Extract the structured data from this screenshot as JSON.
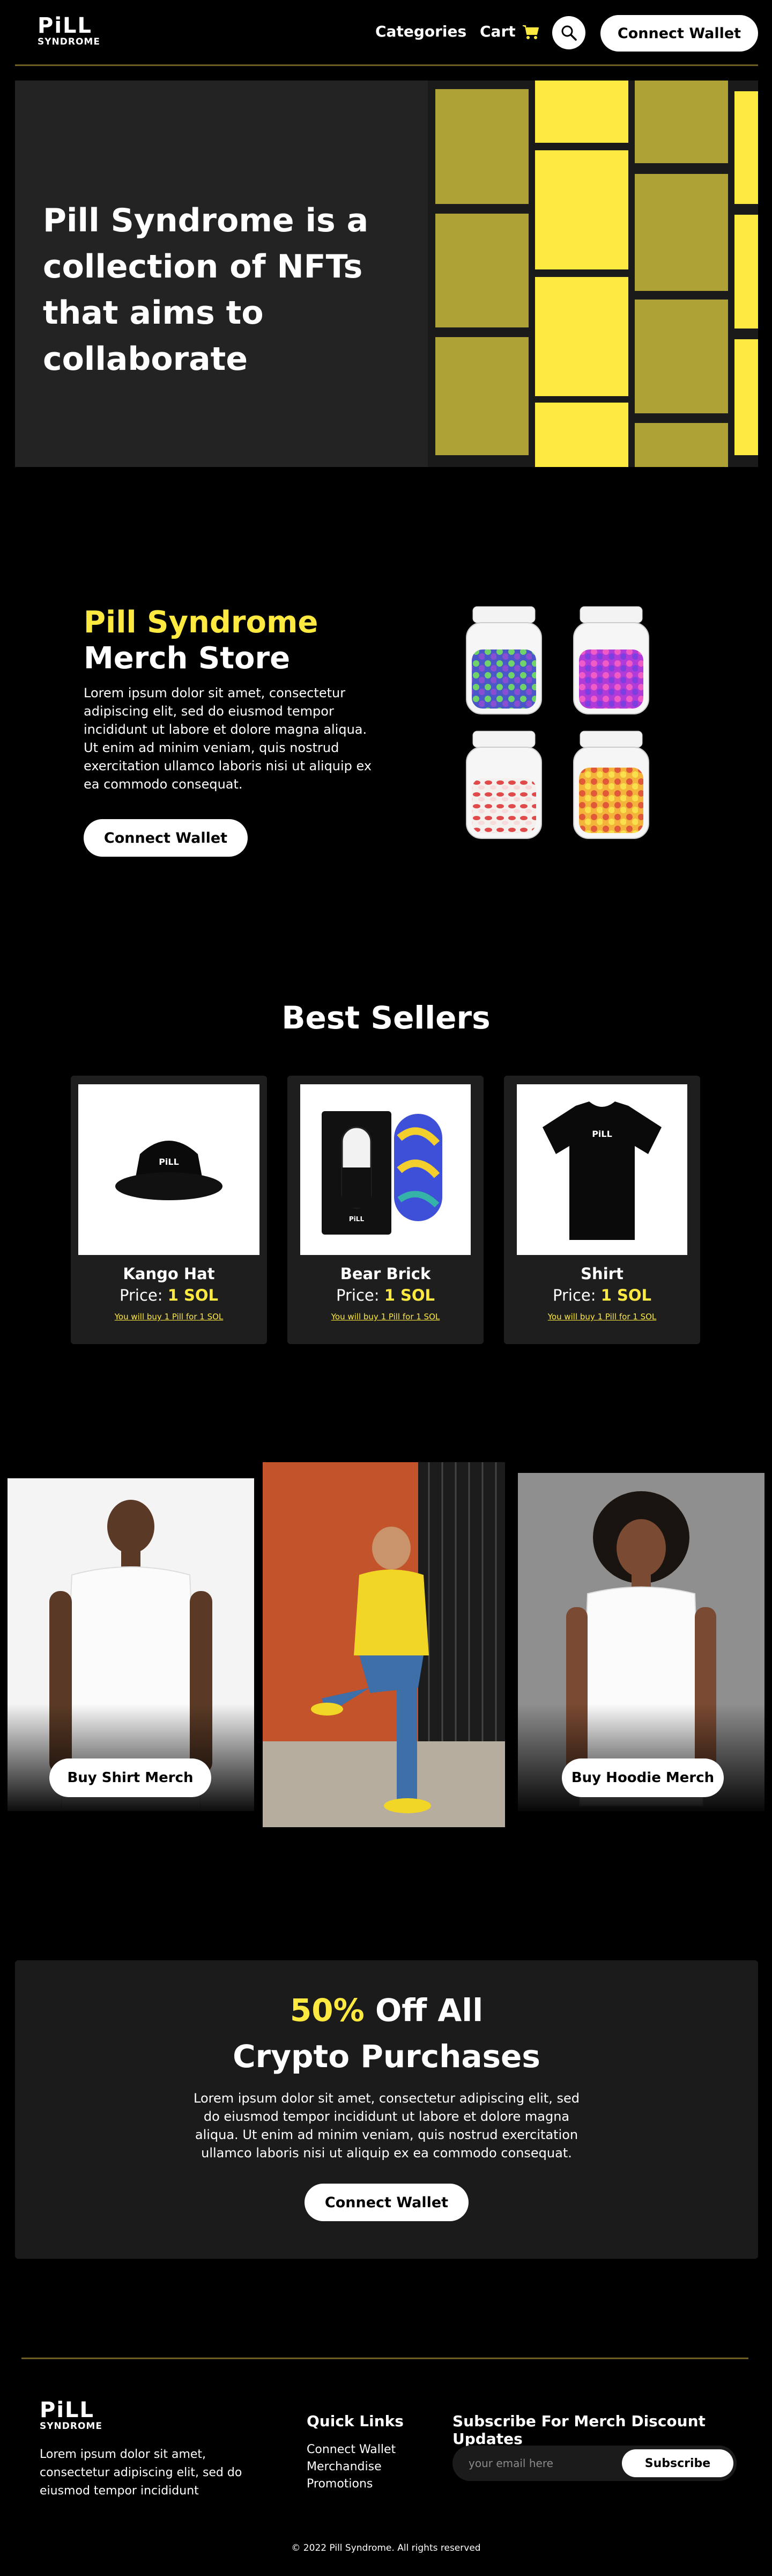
{
  "colors": {
    "accent": "#fee940",
    "background": "#000000",
    "panel": "#232323"
  },
  "header": {
    "logo_line1": "PiLL",
    "logo_line2": "SYNDROME",
    "nav_categories": "Categories",
    "nav_cart": "Cart",
    "cart_icon": "shopping-cart-icon",
    "search_icon": "search-icon",
    "connect_wallet": "Connect Wallet"
  },
  "hero": {
    "title": "Pill Syndrome is a collection of NFTs that aims to collaborate"
  },
  "merch": {
    "title_accent": "Pill Syndrome",
    "title_rest": "Merch Store",
    "description": "Lorem ipsum dolor sit amet, consectetur adipiscing elit, sed do eiusmod tempor incididunt ut labore et dolore magna aliqua. Ut enim ad minim veniam, quis nostrud exercitation ullamco laboris nisi ut aliquip ex ea commodo consequat.",
    "cta": "Connect Wallet"
  },
  "best_sellers": {
    "title": "Best Sellers",
    "price_prefix": "Price:",
    "items": [
      {
        "name": "Kango Hat",
        "price": "1 SOL",
        "note": "You will buy 1 Pill for 1 SOL",
        "image_logo": "PiLL"
      },
      {
        "name": "Bear Brick",
        "price": "1 SOL",
        "note": "You will buy 1 Pill for 1 SOL",
        "image_logo": "PiLL"
      },
      {
        "name": "Shirt",
        "price": "1 SOL",
        "note": "You will buy 1 Pill for 1 SOL",
        "image_logo": "PiLL"
      }
    ]
  },
  "gallery": {
    "shirt_cta": "Buy Shirt Merch",
    "hoodie_cta": "Buy Hoodie Merch"
  },
  "promo": {
    "title_accent": "50%",
    "title_rest_line1": " Off All",
    "title_line2": "Crypto Purchases",
    "description": "Lorem ipsum dolor sit amet, consectetur adipiscing elit, sed do eiusmod tempor incididunt ut labore et dolore magna aliqua. Ut enim ad minim veniam, quis nostrud exercitation ullamco laboris nisi ut aliquip ex ea commodo consequat.",
    "cta": "Connect Wallet"
  },
  "footer": {
    "logo_line1": "PiLL",
    "logo_line2": "SYNDROME",
    "about": "Lorem ipsum dolor sit amet, consectetur adipiscing elit, sed do eiusmod tempor incididunt",
    "quick_links_title": "Quick Links",
    "quick_links": [
      "Connect Wallet",
      "Merchandise",
      "Promotions"
    ],
    "subscribe_title": "Subscribe For Merch Discount Updates",
    "email_placeholder": "your email here",
    "subscribe_button": "Subscribe",
    "copyright": "© 2022 Pill Syndrome. All rights reserved"
  }
}
